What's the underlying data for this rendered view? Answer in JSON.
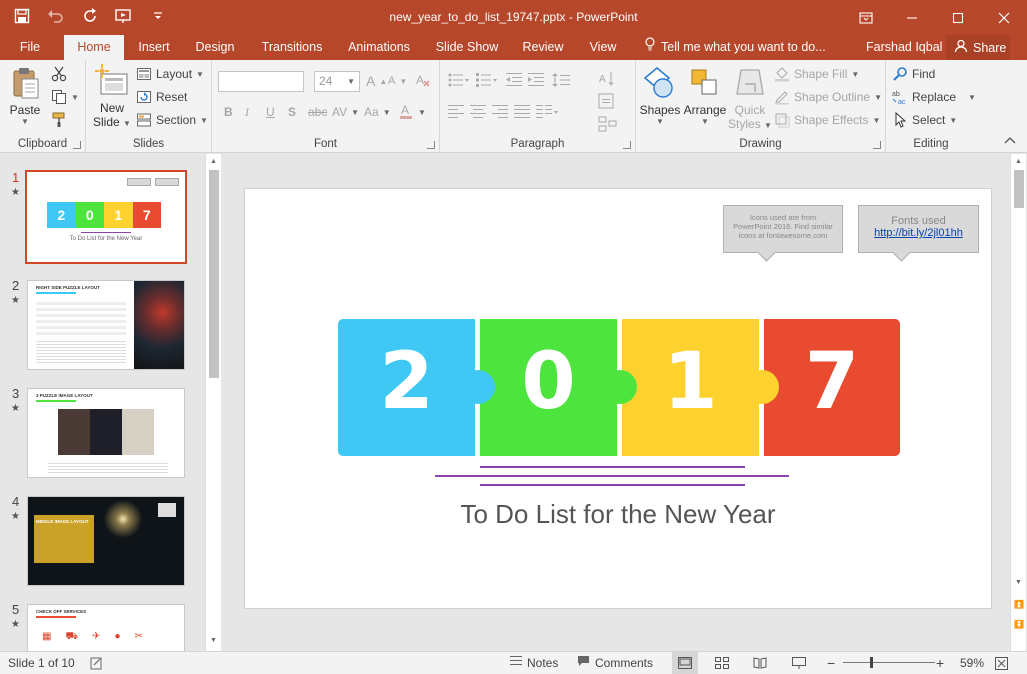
{
  "window": {
    "title": "new_year_to_do_list_19747.pptx - PowerPoint",
    "controls": [
      "ribbon-options",
      "minimize",
      "maximize",
      "close"
    ]
  },
  "tabs": [
    {
      "label": "File",
      "active": false
    },
    {
      "label": "Home",
      "active": true
    },
    {
      "label": "Insert",
      "active": false
    },
    {
      "label": "Design",
      "active": false
    },
    {
      "label": "Transitions",
      "active": false
    },
    {
      "label": "Animations",
      "active": false
    },
    {
      "label": "Slide Show",
      "active": false
    },
    {
      "label": "Review",
      "active": false
    },
    {
      "label": "View",
      "active": false
    }
  ],
  "tellme": "Tell me what you want to do...",
  "user": "Farshad Iqbal",
  "share": "Share",
  "ribbon": {
    "clipboard": {
      "label": "Clipboard",
      "paste": "Paste"
    },
    "slides": {
      "label": "Slides",
      "new_slide_1": "New",
      "new_slide_2": "Slide",
      "layout": "Layout",
      "reset": "Reset",
      "section": "Section"
    },
    "font": {
      "label": "Font",
      "font_name": "",
      "font_size": "24"
    },
    "paragraph": {
      "label": "Paragraph"
    },
    "drawing": {
      "label": "Drawing",
      "shapes": "Shapes",
      "arrange": "Arrange",
      "quick_styles_1": "Quick",
      "quick_styles_2": "Styles",
      "shape_fill": "Shape Fill",
      "shape_outline": "Shape Outline",
      "shape_effects": "Shape Effects"
    },
    "editing": {
      "label": "Editing",
      "find": "Find",
      "replace": "Replace",
      "select": "Select"
    }
  },
  "thumbnails": [
    {
      "num": "1",
      "title": "",
      "caption": "To Do List for the New Year"
    },
    {
      "num": "2",
      "title": "RIGHT SIDE PUZZLE LAYOUT"
    },
    {
      "num": "3",
      "title": "3 PUZZLE IMAGE LAYOUT"
    },
    {
      "num": "4",
      "title": "MIDDLE IMAGE LAYOUT"
    },
    {
      "num": "5",
      "title": "CHECK OFF SERVICES"
    }
  ],
  "slide": {
    "callout_icons": "Icons used are from PowerPoint 2016. Find similar icons at fontawesome.com",
    "callout_fonts_label": "Fonts used",
    "callout_fonts_link": "http://bit.ly/2jl01hh",
    "digits": [
      "2",
      "0",
      "1",
      "7"
    ],
    "piece_colors": [
      "#3fc8f4",
      "#4ee43e",
      "#fdd22f",
      "#e84b2f"
    ],
    "subtitle": "To Do List for the New Year"
  },
  "status": {
    "slide_info": "Slide 1 of 10",
    "notes": "Notes",
    "comments": "Comments",
    "zoom": "59%",
    "zoom_level": 0.59
  }
}
